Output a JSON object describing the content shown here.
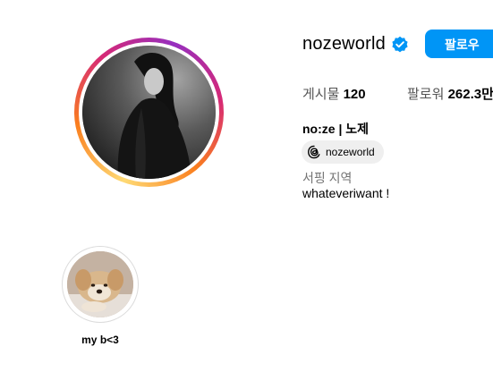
{
  "profile": {
    "username": "nozeworld",
    "verified": true,
    "follow_label": "팔로우",
    "stats": {
      "posts_label": "게시물",
      "posts_count": "120",
      "followers_label": "팔로워",
      "followers_count": "262.3만"
    },
    "full_name": "no:ze | 노제",
    "threads_handle": "nozeworld",
    "category": "서핑 지역",
    "bio": "whateveriwant !"
  },
  "highlights": [
    {
      "label": "my b<3"
    }
  ],
  "colors": {
    "accent": "#0095f6",
    "verified_badge": "#0095f6",
    "muted_text": "#737373"
  },
  "icons": {
    "verified": "verified-badge-icon",
    "threads": "threads-icon"
  }
}
